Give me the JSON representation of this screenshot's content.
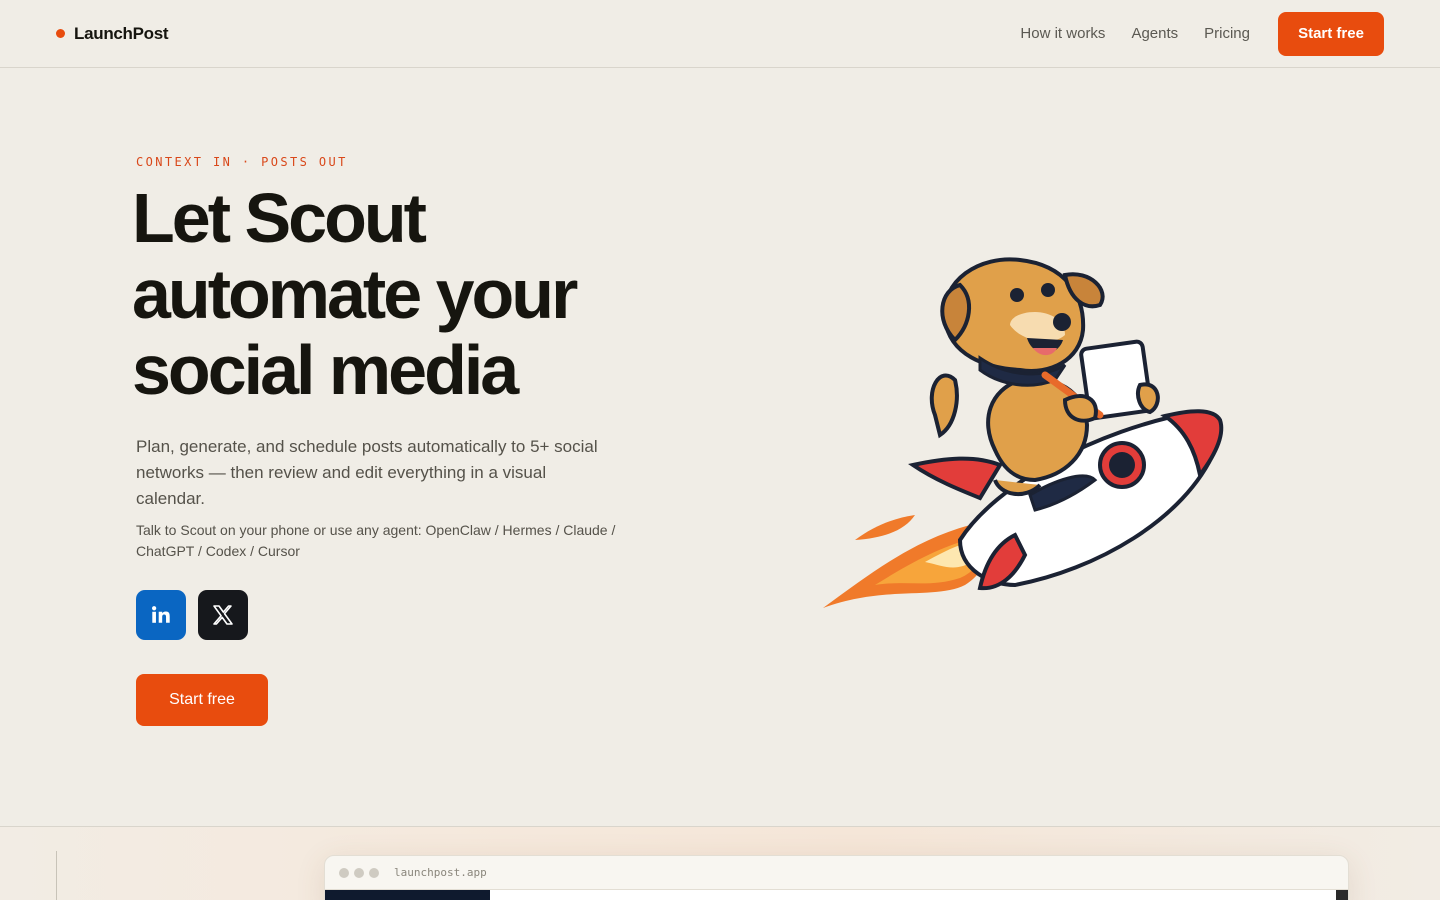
{
  "nav": {
    "brand": "LaunchPost",
    "links": [
      "How it works",
      "Agents",
      "Pricing"
    ],
    "cta": "Start free"
  },
  "hero": {
    "eyebrow": "CONTEXT IN · POSTS OUT",
    "headline": [
      "Let Scout",
      "automate your",
      "social media"
    ],
    "subcopy": "Plan, generate, and schedule posts automatically to 5+ social networks — then review and edit everything in a visual calendar.",
    "agents": "Talk to Scout on your phone or use any agent: OpenClaw / Hermes / Claude / ChatGPT / Codex / Cursor",
    "socials": [
      {
        "icon": "linkedin-icon",
        "color": "#0a66c2"
      },
      {
        "icon": "x-icon",
        "color": "#16181c"
      }
    ],
    "cta": "Start free"
  },
  "preview": {
    "url": "launchpost.app"
  },
  "colors": {
    "accent": "#e84c0e",
    "background": "#f0ede6",
    "text": "#16150f"
  }
}
